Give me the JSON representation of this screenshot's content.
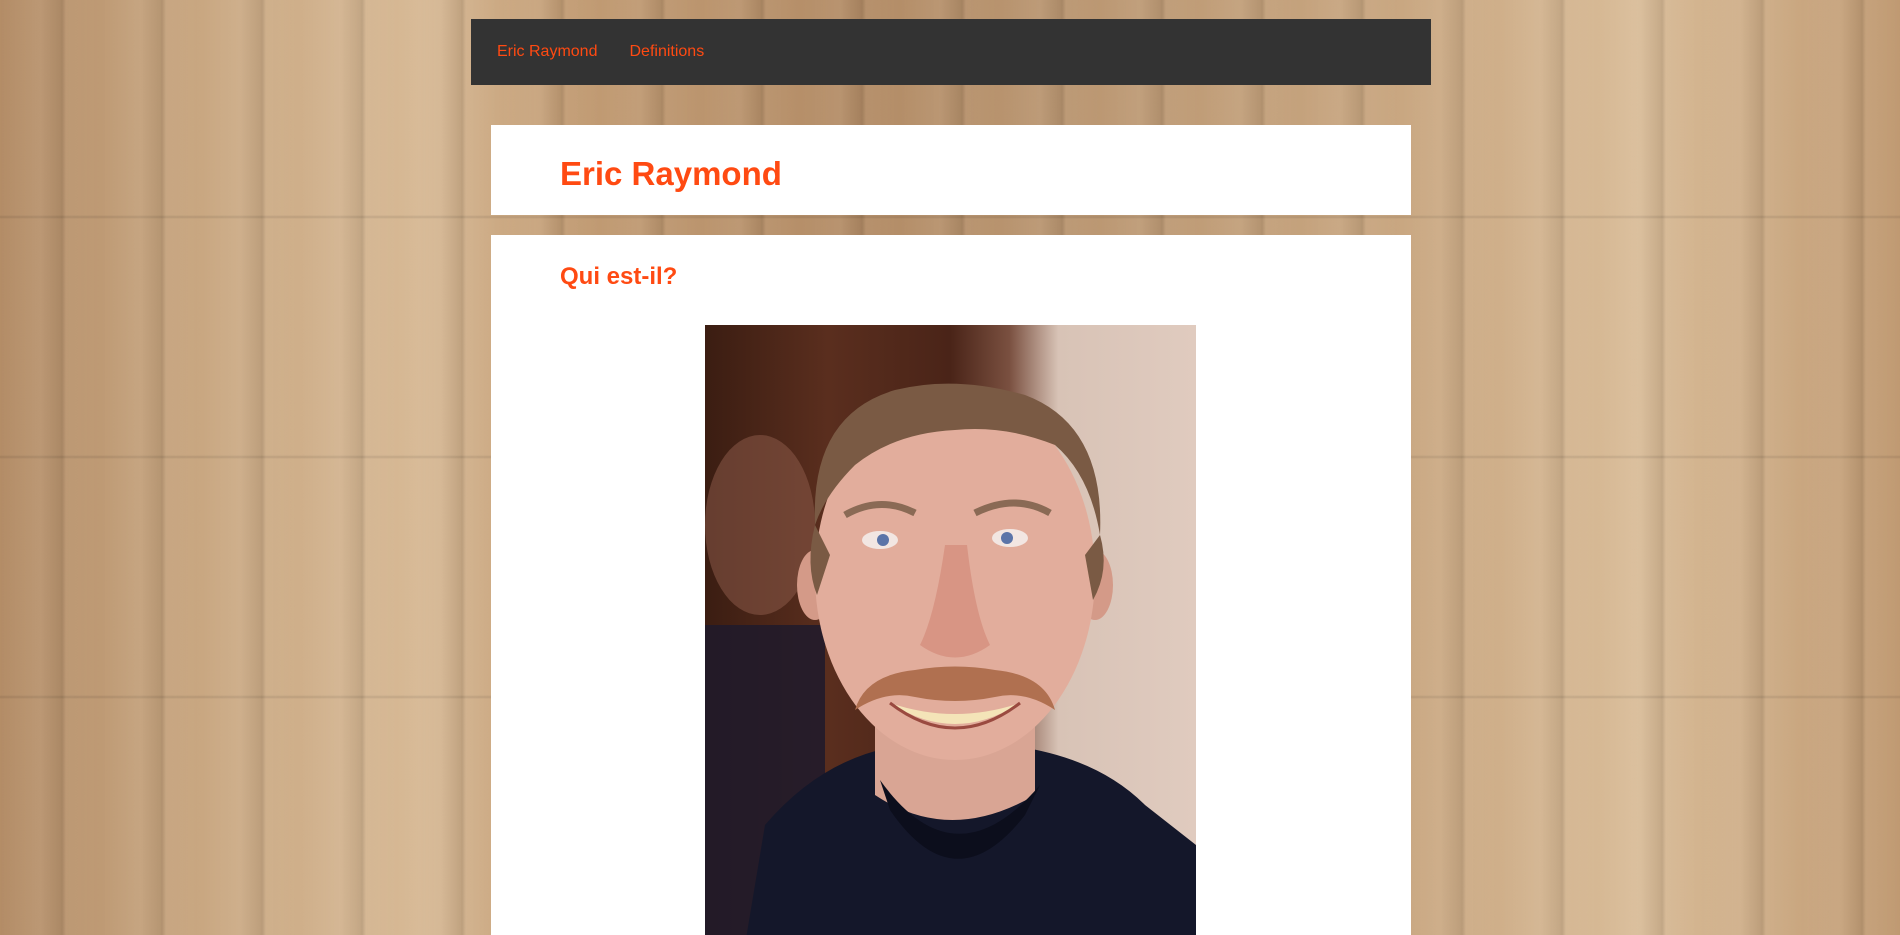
{
  "nav": {
    "items": [
      {
        "label": "Eric Raymond"
      },
      {
        "label": "Definitions"
      }
    ]
  },
  "header": {
    "title": "Eric Raymond"
  },
  "main": {
    "section_title": "Qui est-il?",
    "image": {
      "subject": "portrait photo of a smiling man with a mustache"
    }
  },
  "colors": {
    "accent": "#ff4a12",
    "nav_background": "#333333",
    "panel_background": "#ffffff"
  }
}
